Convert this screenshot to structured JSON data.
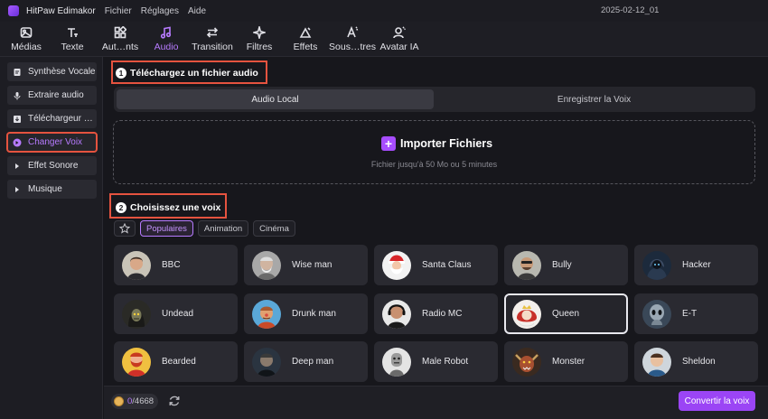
{
  "titlebar": {
    "app_name": "HitPaw Edimakor",
    "menu": [
      "Fichier",
      "Réglages",
      "Aide"
    ],
    "project_name": "2025-02-12_01"
  },
  "toolbar": {
    "tools": [
      {
        "label": "Médias",
        "icon": "media-icon"
      },
      {
        "label": "Texte",
        "icon": "text-icon"
      },
      {
        "label": "Aut…nts",
        "icon": "elements-icon"
      },
      {
        "label": "Audio",
        "icon": "music-note-icon",
        "active": true
      },
      {
        "label": "Transition",
        "icon": "transition-arrows-icon"
      },
      {
        "label": "Filtres",
        "icon": "sparkle-icon"
      },
      {
        "label": "Effets",
        "icon": "effects-icon"
      },
      {
        "label": "Sous…tres",
        "icon": "subtitle-icon"
      },
      {
        "label": "Avatar IA",
        "icon": "avatar-ai-icon"
      }
    ]
  },
  "sidebar": {
    "items": [
      {
        "label": "Synthèse Vocale",
        "icon": "document-voice-icon"
      },
      {
        "label": "Extraire audio",
        "icon": "microphone-icon"
      },
      {
        "label": "Téléchargeur …",
        "icon": "download-icon"
      },
      {
        "label": "Changer Voix",
        "icon": "voice-change-icon",
        "active": true
      },
      {
        "label": "Effet Sonore",
        "icon": "triangle-right-icon"
      },
      {
        "label": "Musique",
        "icon": "triangle-right-icon"
      }
    ]
  },
  "upload": {
    "step": "1",
    "title": "Téléchargez un fichier audio",
    "tabs": [
      "Audio Local",
      "Enregistrer la Voix"
    ],
    "import_label": "Importer Fichiers",
    "import_hint": "Fichier jusqu'à 50 Mo ou 5 minutes"
  },
  "voices": {
    "step": "2",
    "title": "Choisissez une voix",
    "filters": [
      "Populaires",
      "Animation",
      "Cinéma"
    ],
    "active_filter": "Populaires",
    "items": [
      {
        "name": "BBC"
      },
      {
        "name": "Wise man"
      },
      {
        "name": "Santa Claus"
      },
      {
        "name": "Bully"
      },
      {
        "name": "Hacker"
      },
      {
        "name": "Undead"
      },
      {
        "name": "Drunk man"
      },
      {
        "name": "Radio MC"
      },
      {
        "name": "Queen",
        "selected": true
      },
      {
        "name": "E-T"
      },
      {
        "name": "Bearded"
      },
      {
        "name": "Deep man"
      },
      {
        "name": "Male Robot"
      },
      {
        "name": "Monster"
      },
      {
        "name": "Sheldon"
      }
    ]
  },
  "footer": {
    "credits_used": "0",
    "credits_total": "/4668",
    "convert_label": "Convertir la voix"
  },
  "colors": {
    "accent": "#9b45f5",
    "highlight_box": "#e5533f"
  }
}
